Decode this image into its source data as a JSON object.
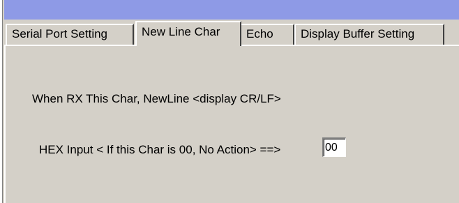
{
  "tabs": [
    {
      "label": "Serial Port Setting",
      "active": false
    },
    {
      "label": "New Line Char",
      "active": true
    },
    {
      "label": "Echo",
      "active": false
    },
    {
      "label": "Display Buffer Setting",
      "active": false
    }
  ],
  "panel": {
    "rx_label": "When RX This Char, NewLine <display CR/LF>",
    "hex_label": "HEX Input < If this Char is 00, No Action> ==>",
    "hex_value": "00"
  },
  "colors": {
    "title_bar": "#8e9ae6",
    "face": "#d4d0c8"
  }
}
